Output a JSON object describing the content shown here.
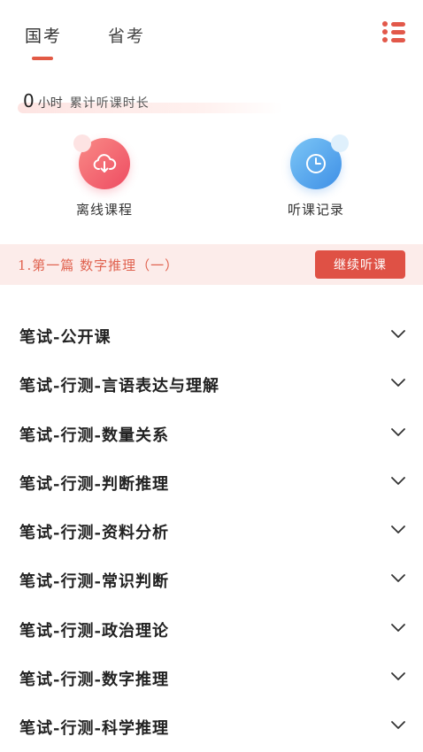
{
  "tabs": [
    {
      "label": "国考",
      "active": true
    },
    {
      "label": "省考",
      "active": false
    }
  ],
  "menu_icon": "list-menu-icon",
  "study_time": {
    "value": "0",
    "unit": "小时",
    "label": "累计听课时长"
  },
  "quick_actions": [
    {
      "label": "离线课程",
      "icon": "cloud-download-icon",
      "color": "#ee4c62"
    },
    {
      "label": "听课记录",
      "icon": "clock-icon",
      "color": "#3e8fe6"
    }
  ],
  "continue": {
    "lesson": "1.第一篇 数字推理（一）",
    "button_label": "继续听课"
  },
  "courses": [
    {
      "title": "笔试-公开课"
    },
    {
      "title": "笔试-行测-言语表达与理解"
    },
    {
      "title": "笔试-行测-数量关系"
    },
    {
      "title": "笔试-行测-判断推理"
    },
    {
      "title": "笔试-行测-资料分析"
    },
    {
      "title": "笔试-行测-常识判断"
    },
    {
      "title": "笔试-行测-政治理论"
    },
    {
      "title": "笔试-行测-数字推理"
    },
    {
      "title": "笔试-行测-科学推理"
    }
  ],
  "colors": {
    "accent": "#e25a45",
    "continue_bg": "#fcecea"
  }
}
